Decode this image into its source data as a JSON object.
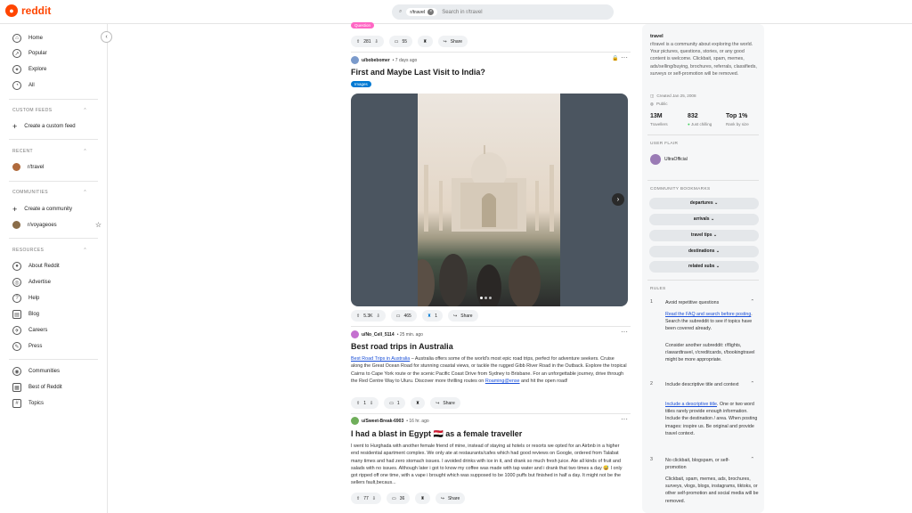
{
  "brand": {
    "name": "reddit"
  },
  "search": {
    "community": "r/travel",
    "placeholder": "Search in r/travel"
  },
  "sidebar": {
    "main": [
      {
        "label": "Home",
        "icon": "home-icon"
      },
      {
        "label": "Popular",
        "icon": "popular-icon"
      },
      {
        "label": "Explore",
        "icon": "explore-icon"
      },
      {
        "label": "All",
        "icon": "all-icon"
      }
    ],
    "custom_feeds": {
      "heading": "CUSTOM FEEDS",
      "create": "Create a custom feed"
    },
    "recent": {
      "heading": "RECENT",
      "items": [
        "r/travel"
      ]
    },
    "communities": {
      "heading": "COMMUNITIES",
      "create": "Create a community",
      "items": [
        "r/voyageoes"
      ]
    },
    "resources": {
      "heading": "RESOURCES",
      "items": [
        "About Reddit",
        "Advertise",
        "Help",
        "Blog",
        "Careers",
        "Press"
      ]
    },
    "bottom": [
      "Communities",
      "Best of Reddit",
      "Topics"
    ]
  },
  "feed": {
    "top_flair": "Question",
    "top_actions": {
      "votes": "281",
      "comments": "55",
      "share": "Share"
    },
    "posts": [
      {
        "user": "u/bobebomer",
        "time": "• 7 days ago",
        "title": "First and Maybe Last Visit to India?",
        "flair": "Images",
        "votes": "5.3K",
        "comments": "465",
        "awards": "1",
        "share": "Share"
      },
      {
        "user": "u/No_Cell_5114",
        "time": "• 25 min. ago",
        "title": "Best road trips in Australia",
        "body_link": "Best Road Trips in Australia",
        "body": " – Australia offers some of the world's most epic road trips, perfect for adventure seekers. Cruise along the Great Ocean Road for stunning coastal views, or tackle the rugged Gibb River Road in the Outback. Explore the tropical Cairns to Cape York route or the scenic Pacific Coast Drive from Sydney to Brisbane. For an unforgettable journey, drive through the Red Centre Way to Uluru. Discover more thrilling routes on ",
        "body_link2": "Roaming@ense",
        "body_end": " and hit the open road!",
        "votes": "1",
        "comments": "1",
        "share": "Share"
      },
      {
        "user": "u/Sweet-Break-6903",
        "time": "• 16 hr. ago",
        "title": "I had a blast in Egypt 🇪🇬 as a female traveller",
        "body": "I went to Hurghada with another female friend of mine, instead of staying at hotels or resorts we opted for an Airbnb in a higher end residential apartment complex. We only ate at restaurants/cafes which had good reviews on Google, ordered from Talabat many times and had zero stomach issues. I avoided drinks with ice in it, and drank so much fresh juice. Ate all kinds of fruit and salads with no issues. Although later i got to know my coffee was made with tap water and i drank that two times a day 😅 I only got ripped off one time, with a vape i brought which was supposed to be 1000 puffs but finished in half a day. It might not be the sellers fault,becaus...",
        "votes": "77",
        "comments": "36",
        "share": "Share"
      }
    ]
  },
  "right": {
    "title": "travel",
    "desc": "r/travel is a community about exploring the world. Your pictures, questions, stories, or any good content is welcome. Clickbait, spam, memes, ads/selling/buying, brochures, referrals, classifieds, surveys or self-promotion will be removed.",
    "created": "Created Jan 25, 2008",
    "visibility": "Public",
    "stats": [
      {
        "n": "13M",
        "l": "Travellers"
      },
      {
        "n": "832",
        "l": "Just chilling"
      },
      {
        "n": "Top 1%",
        "l": "Rank by size"
      }
    ],
    "user_flair_heading": "USER FLAIR",
    "user_flair": "UltraOfficial",
    "bookmarks_heading": "COMMUNITY BOOKMARKS",
    "bookmarks": [
      "departures",
      "arrivals",
      "travel tips",
      "destinations",
      "related subs"
    ],
    "rules_heading": "RULES",
    "rules": [
      {
        "n": "1",
        "t": "Avoid repetitive questions"
      },
      {
        "n": "2",
        "t": "Include descriptive title and context"
      },
      {
        "n": "3",
        "t": "No clickbait, blogspam, or self-promotion"
      }
    ],
    "rule1_link": "Read the FAQ and search before posting",
    "rule1_text": ". Search the subreddit to see if topics have been covered already.",
    "rule1_more": "Consider another subreddit: r/flights, r/awardtravel, r/creditcards, r/bookingtravel might be more appropriate.",
    "rule2_link": "Include a descriptive title",
    "rule2_text": ". One or two word titles rarely provide enough information. Include the destination / area. When posting images: inspire us. Be original and provide travel context.",
    "rule3_text": "Clickbait, spam, memes, ads, brochures, surveys, vlogs, blogs, instagrams, tiktoks, or other self-promotion and social media will be removed."
  }
}
